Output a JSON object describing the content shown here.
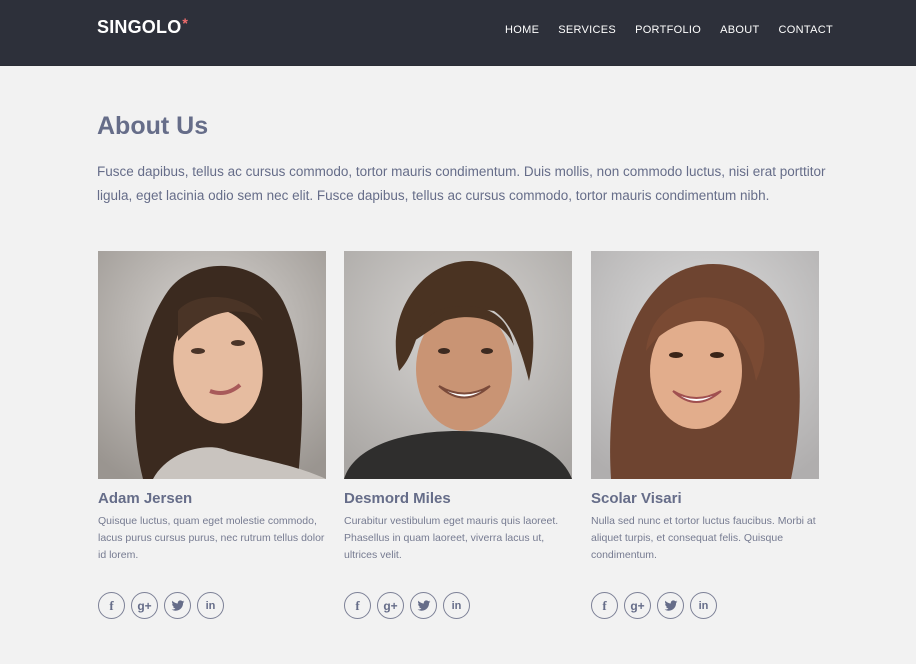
{
  "header": {
    "logo": "SINGOLO",
    "logo_star": "*",
    "nav": [
      "HOME",
      "SERVICES",
      "PORTFOLIO",
      "ABOUT",
      "CONTACT"
    ]
  },
  "about": {
    "title": "About Us",
    "text": "Fusce dapibus, tellus ac cursus commodo, tortor mauris condimentum. Duis mollis, non commodo luctus, nisi erat porttitor ligula, eget lacinia odio sem nec elit. Fusce dapibus, tellus ac cursus commodo, tortor mauris condimentum nibh."
  },
  "team": [
    {
      "name": "Adam Jersen",
      "text": "Quisque luctus, quam eget molestie commodo, lacus purus cursus purus, nec rutrum tellus dolor id lorem."
    },
    {
      "name": "Desmord Miles",
      "text": "Curabitur vestibulum eget mauris quis laoreet. Phasellus in quam laoreet, viverra lacus ut, ultrices velit."
    },
    {
      "name": "Scolar Visari",
      "text": "Nulla sed nunc et tortor luctus faucibus. Morbi at aliquet turpis, et consequat felis. Quisque condimentum."
    }
  ],
  "social_icons": {
    "facebook": "f",
    "googleplus": "g+",
    "linkedin": "in"
  },
  "colors": {
    "header_bg": "#2d303a",
    "accent": "#f06d6d",
    "text": "#666d89",
    "page_bg": "#f2f2f2"
  }
}
